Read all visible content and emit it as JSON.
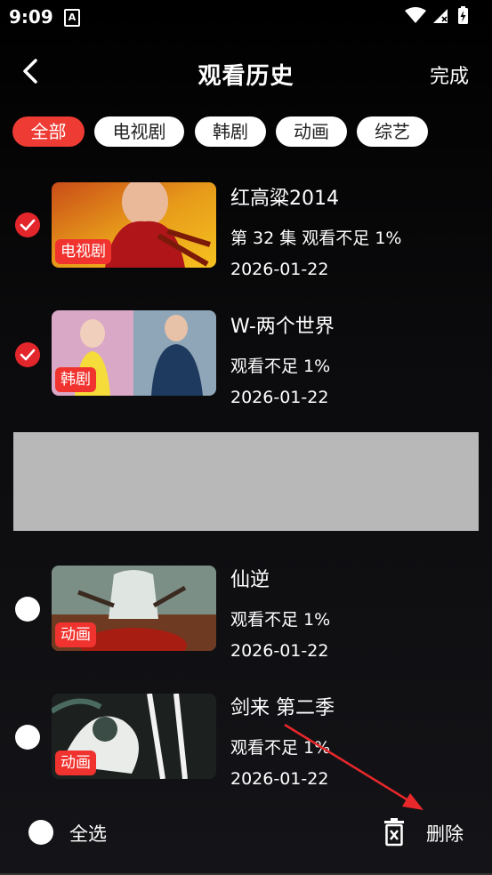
{
  "status_bar": {
    "time": "9:09",
    "notification_letter": "A"
  },
  "header": {
    "title": "观看历史",
    "done_label": "完成"
  },
  "filters": [
    {
      "label": "全部",
      "active": true
    },
    {
      "label": "电视剧",
      "active": false
    },
    {
      "label": "韩剧",
      "active": false
    },
    {
      "label": "动画",
      "active": false
    },
    {
      "label": "综艺",
      "active": false
    }
  ],
  "items": [
    {
      "title": "红高粱2014",
      "progress": "第 32 集 观看不足 1%",
      "date": "2026-01-22",
      "badge": "电视剧",
      "selected": true
    },
    {
      "title": "W-两个世界",
      "progress": "观看不足 1%",
      "date": "2026-01-22",
      "badge": "韩剧",
      "selected": true
    },
    {
      "title": "仙逆",
      "progress": "观看不足 1%",
      "date": "2026-01-22",
      "badge": "动画",
      "selected": false
    },
    {
      "title": "剑来 第二季",
      "progress": "观看不足 1%",
      "date": "2026-01-22",
      "badge": "动画",
      "selected": false
    }
  ],
  "bottom_bar": {
    "select_all_label": "全选",
    "delete_label": "删除"
  },
  "colors": {
    "accent": "#ee3b34",
    "background": "#000000",
    "placeholder": "#b8b8b8",
    "annotation_arrow": "#e8282b"
  }
}
